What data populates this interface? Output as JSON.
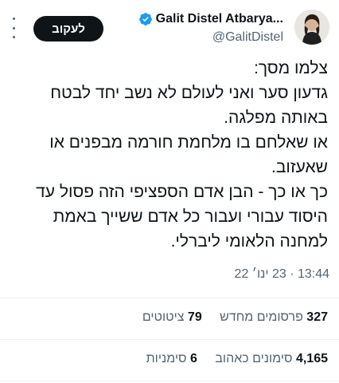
{
  "author": {
    "display_name": "Galit Distel Atbarya...",
    "handle": "@GalitDistel",
    "verified": true
  },
  "actions": {
    "follow_label": "לעקוב",
    "more_icon": "more-vertical-icon"
  },
  "tweet": {
    "lines": [
      "צלמו מסך:",
      "גדעון סער ואני לעולם לא נשב יחד לבטח",
      "באותה מפלגה.",
      "או שאלחם בו מלחמת חורמה מבפנים או",
      "שאעזוב.",
      "כך או כך - הבן אדם הספציפי הזה פסול עד",
      "היסוד עבורי ועבור כל אדם ששייך באמת",
      "למחנה הלאומי ליברלי."
    ],
    "timestamp": "13:44 · 23 ינו׳ 22"
  },
  "stats": {
    "retweets_count": "327",
    "retweets_label": "פרסומים מחדש",
    "quotes_count": "79",
    "quotes_label": "ציטוטים",
    "likes_count": "4,165",
    "likes_label": "סימונים כאהוב",
    "bookmarks_count": "6",
    "bookmarks_label": "סימניות"
  },
  "colors": {
    "text": "#0f1419",
    "secondary": "#536471",
    "divider": "#eff3f4",
    "verified": "#1d9bf0"
  }
}
